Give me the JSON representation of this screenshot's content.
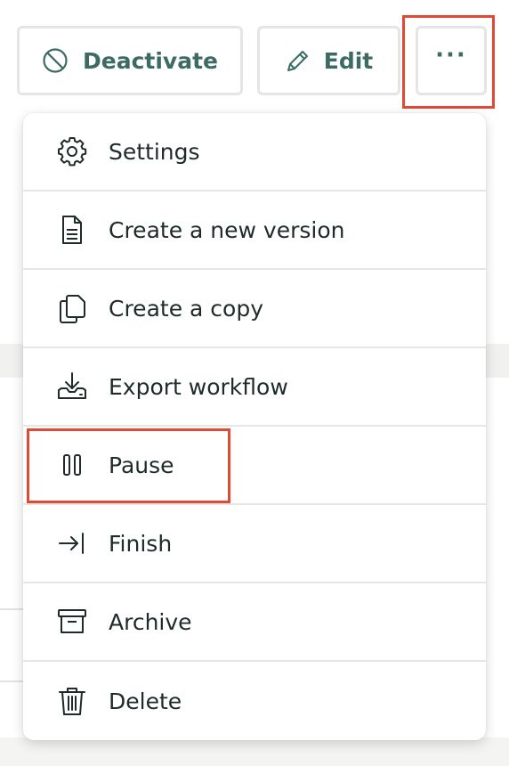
{
  "toolbar": {
    "deactivate_label": "Deactivate",
    "edit_label": "Edit",
    "more_label": "···"
  },
  "menu": {
    "items": [
      {
        "label": "Settings",
        "icon": "gear-icon"
      },
      {
        "label": "Create a new version",
        "icon": "document-icon"
      },
      {
        "label": "Create a copy",
        "icon": "copy-icon"
      },
      {
        "label": "Export workflow",
        "icon": "download-tray-icon"
      },
      {
        "label": "Pause",
        "icon": "pause-icon"
      },
      {
        "label": "Finish",
        "icon": "arrow-to-bar-icon"
      },
      {
        "label": "Archive",
        "icon": "archive-box-icon"
      },
      {
        "label": "Delete",
        "icon": "trash-icon"
      }
    ]
  },
  "colors": {
    "accent_text": "#3c6b64",
    "highlight": "#e04a35",
    "menu_text": "#1f2a2a"
  }
}
